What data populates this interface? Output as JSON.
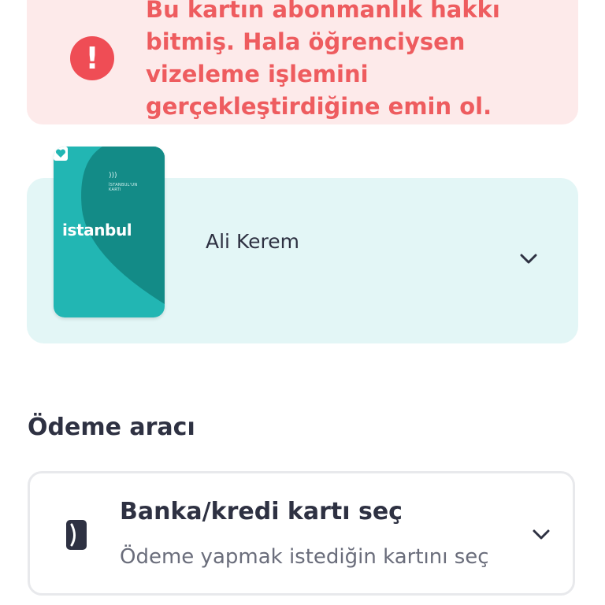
{
  "alert": {
    "icon": "exclamation-icon",
    "message": "Bu kartın abonmanlık hakkı\nbitmiş. Hala öğrenciysen\nvizeleme işlemini\ngerçekleştirdiğine emin ol.",
    "color": "#ee5c5f",
    "background": "#fdeaea"
  },
  "card": {
    "nfc_icon": "contactless-icon",
    "small_text": "İSTANBUL'UN\nKARTI",
    "logo_text": "istanbul",
    "logo_icon": "heart-icon",
    "holder_name": "Ali Kerem",
    "expand_icon": "chevron-down-icon",
    "panel_color": "#e3f6f6",
    "card_color": "#22b6b3"
  },
  "payment": {
    "section_title": "Ödeme aracı",
    "method_icon": "card-icon",
    "method_title": "Banka/kredi kartı seç",
    "method_subtitle": "Ödeme yapmak istediğin kartını seç",
    "expand_icon": "chevron-down-icon"
  }
}
